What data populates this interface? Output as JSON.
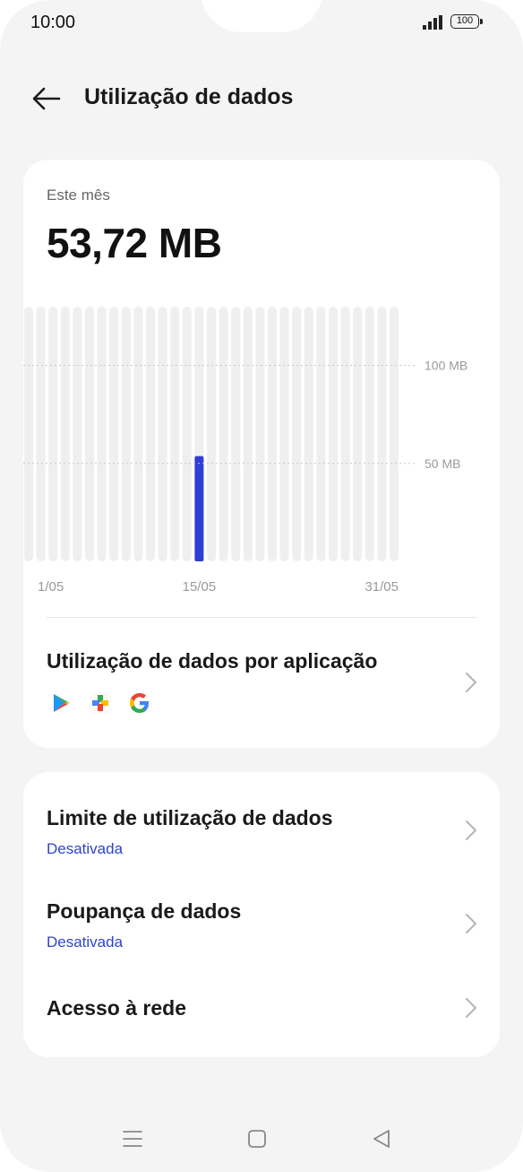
{
  "status_bar": {
    "time": "10:00",
    "battery": "100",
    "icons": [
      "signal-icon",
      "battery-icon"
    ]
  },
  "header": {
    "title": "Utilização de dados",
    "back_icon": "arrow-left-icon"
  },
  "usage": {
    "period_label": "Este mês",
    "total": "53,72 MB"
  },
  "chart_data": {
    "type": "bar",
    "categories": [
      "1/05",
      "2/05",
      "3/05",
      "4/05",
      "5/05",
      "6/05",
      "7/05",
      "8/05",
      "9/05",
      "10/05",
      "11/05",
      "12/05",
      "13/05",
      "14/05",
      "15/05",
      "16/05",
      "17/05",
      "18/05",
      "19/05",
      "20/05",
      "21/05",
      "22/05",
      "23/05",
      "24/05",
      "25/05",
      "26/05",
      "27/05",
      "28/05",
      "29/05",
      "30/05",
      "31/05"
    ],
    "values": [
      0,
      0,
      0,
      0,
      0,
      0,
      0,
      0,
      0,
      0,
      0,
      0,
      0,
      0,
      53.72,
      0,
      0,
      0,
      0,
      0,
      0,
      0,
      0,
      0,
      0,
      0,
      0,
      0,
      0,
      0,
      0
    ],
    "x_tick_labels": [
      "1/05",
      "15/05",
      "31/05"
    ],
    "y_tick_labels": [
      "100 MB",
      "50 MB"
    ],
    "ylim": [
      0,
      130
    ],
    "bar_color": "#2f3fd6",
    "track_color": "#efefef"
  },
  "app_usage": {
    "title": "Utilização de dados por aplicação",
    "apps": [
      "google-play-icon",
      "google-one-icon",
      "google-icon"
    ]
  },
  "settings": [
    {
      "title": "Limite de utilização de dados",
      "status": "Desativada"
    },
    {
      "title": "Poupança de dados",
      "status": "Desativada"
    },
    {
      "title": "Acesso à rede",
      "status": ""
    }
  ],
  "nav_bar": {
    "icons": [
      "menu-icon",
      "home-icon",
      "back-icon"
    ]
  },
  "colors": {
    "accent": "#2f44c9",
    "background": "#f4f4f4",
    "card": "#ffffff"
  }
}
